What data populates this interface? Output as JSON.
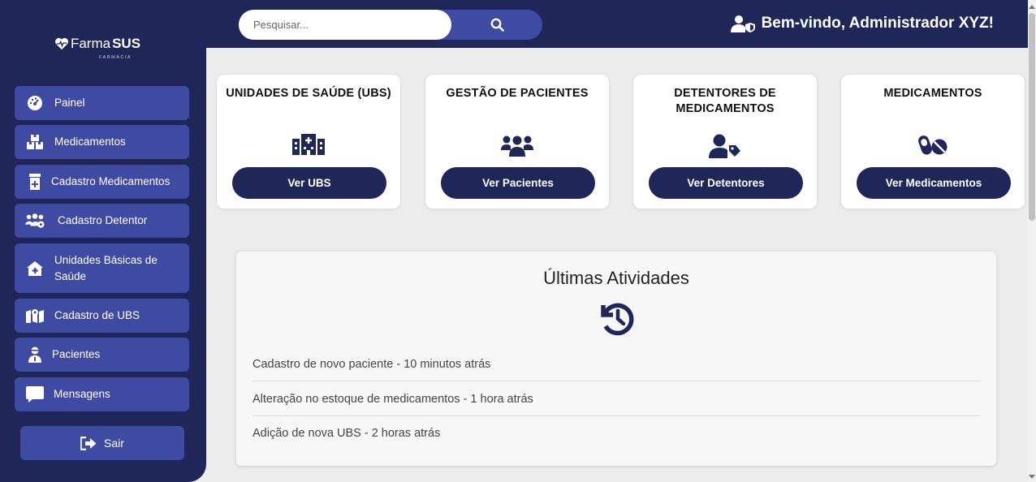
{
  "brand": {
    "name_thin": "Farma",
    "name_bold": "SUS",
    "subtitle": "FARMÁCIA"
  },
  "sidebar": {
    "items": [
      {
        "label": "Painel",
        "icon": "dashboard-gauge-icon"
      },
      {
        "label": "Medicamentos",
        "icon": "boxes-icon"
      },
      {
        "label": "Cadastro Medicamentos",
        "icon": "prescription-bottle-icon"
      },
      {
        "label": "Cadastro Detentor",
        "icon": "users-gear-icon"
      },
      {
        "label": "Unidades Básicas de Saúde",
        "icon": "house-medical-icon"
      },
      {
        "label": "Cadastro de UBS",
        "icon": "map-location-icon"
      },
      {
        "label": "Pacientes",
        "icon": "user-doctor-icon"
      },
      {
        "label": "Mensagens",
        "icon": "message-icon"
      }
    ],
    "logout_label": "Sair"
  },
  "topbar": {
    "search_placeholder": "Pesquisar...",
    "welcome_text": "Bem-vindo, Administrador XYZ!"
  },
  "cards": [
    {
      "title": "UNIDADES DE SAÚDE (UBS)",
      "button": "Ver UBS",
      "icon": "hospital-icon"
    },
    {
      "title": "GESTÃO DE PACIENTES",
      "button": "Ver Pacientes",
      "icon": "users-icon"
    },
    {
      "title": "DETENTORES DE MEDICAMENTOS",
      "button": "Ver Detentores",
      "icon": "user-tag-icon"
    },
    {
      "title": "MEDICAMENTOS",
      "button": "Ver Medicamentos",
      "icon": "pills-icon"
    }
  ],
  "activities": {
    "title": "Últimas Atividades",
    "items": [
      "Cadastro de novo paciente - 10 minutos atrás",
      "Alteração no estoque de medicamentos - 1 hora atrás",
      "Adição de nova UBS - 2 horas atrás"
    ]
  },
  "colors": {
    "navy": "#1f2759",
    "accent": "#3f4aa3",
    "background": "#ececec"
  }
}
